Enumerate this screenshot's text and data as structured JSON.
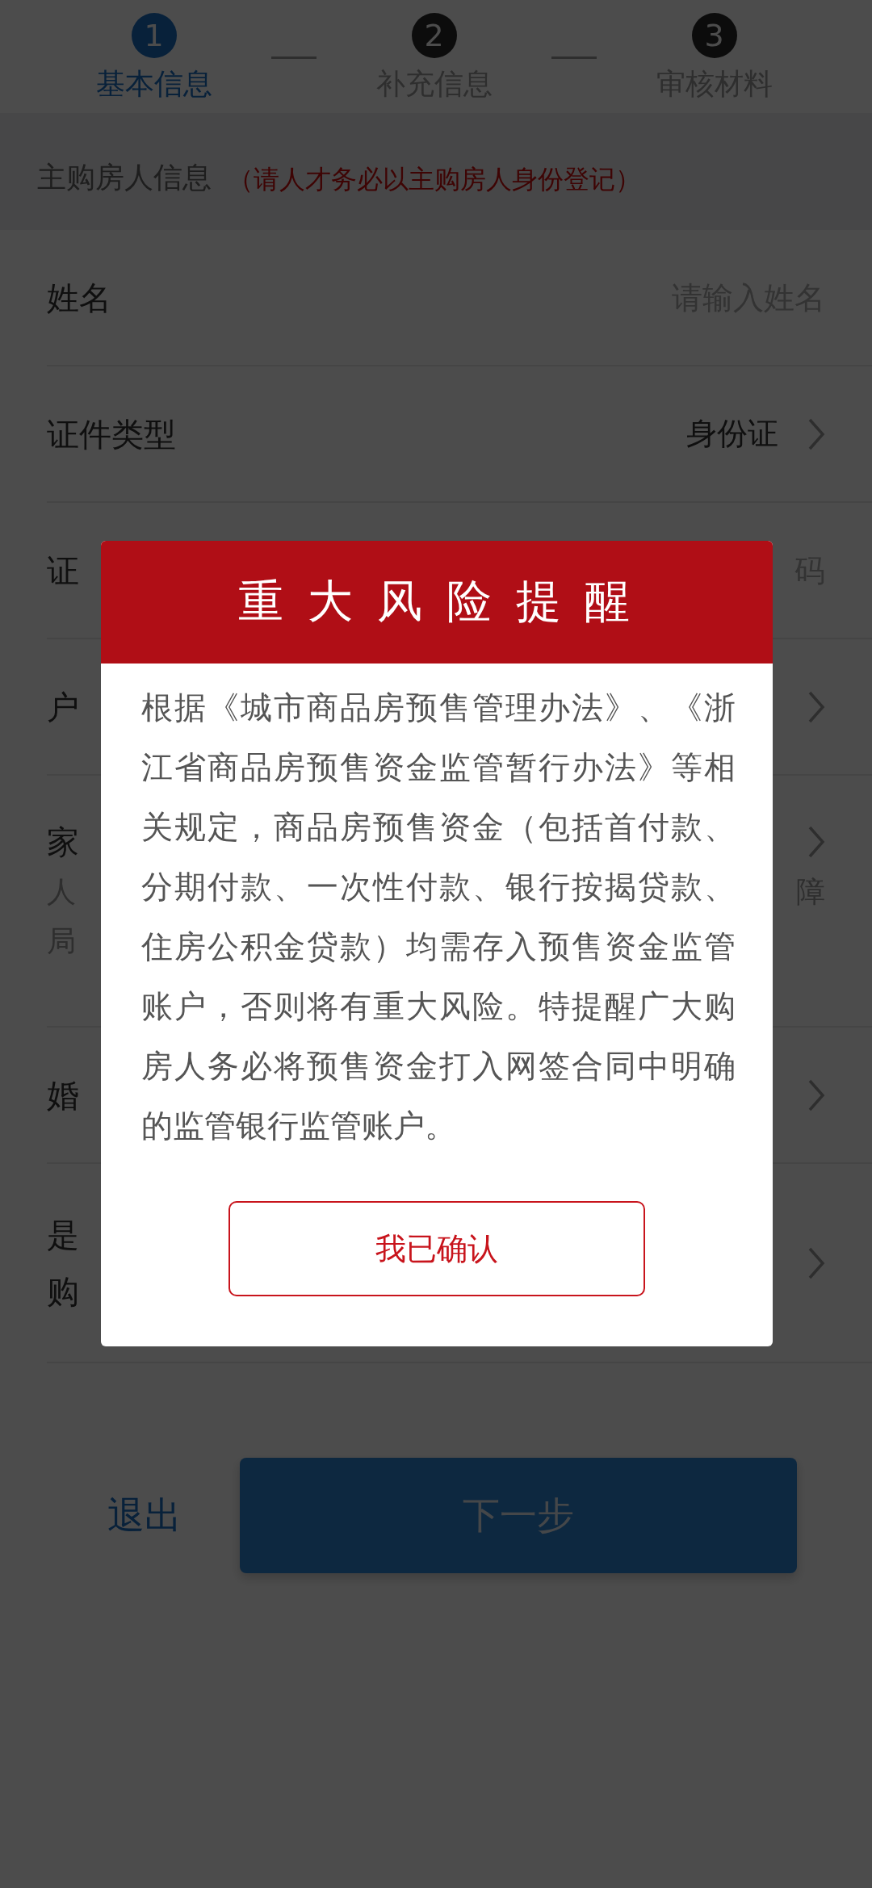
{
  "steps": [
    {
      "number": "1",
      "label": "基本信息",
      "selected": true
    },
    {
      "number": "2",
      "label": "补充信息",
      "selected": false
    },
    {
      "number": "3",
      "label": "审核材料",
      "selected": false
    }
  ],
  "section": {
    "title": "主购房人信息",
    "note": "（请人才务必以主购房人身份登记）"
  },
  "form_rows": [
    {
      "kind": "input",
      "label": "姓名",
      "placeholder": "请输入姓名"
    },
    {
      "kind": "select",
      "label": "证件类型",
      "value": "身份证"
    },
    {
      "kind": "input",
      "label": "证",
      "placeholder": "码"
    },
    {
      "kind": "select",
      "label": "户"
    },
    {
      "kind": "select",
      "label": "家",
      "notes": [
        {
          "left": "人",
          "right": "障"
        },
        {
          "left": "局"
        }
      ]
    },
    {
      "kind": "select",
      "label": "婚"
    },
    {
      "kind": "select",
      "label": "是",
      "label_2": "购"
    }
  ],
  "buttons": {
    "exit": "退出",
    "next": "下一步"
  },
  "dialog": {
    "title": "重 大 风 险 提 醒",
    "message": "根据《城市商品房预售管理办法》、《浙江省商品房预售资金监管暂行办法》等相关规定，商品房预售资金（包括首付款、分期付款、一次性付款、银行按揭贷款、住房公积金贷款）均需存入预售资金监管账户，否则将有重大风险。特提醒广大购房人务必将预售资金打入网签合同中明确的监管银行监管账户。",
    "confirm": "我已确认"
  }
}
